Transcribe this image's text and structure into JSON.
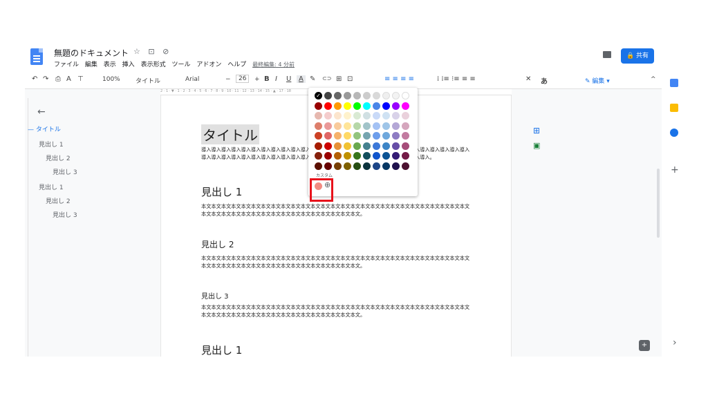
{
  "header": {
    "doc_title": "無題のドキュメント",
    "title_icons": "☆ ⊡ ⊘",
    "menus": [
      "ファイル",
      "編集",
      "表示",
      "挿入",
      "表示形式",
      "ツール",
      "アドオン",
      "ヘルプ"
    ],
    "last_edit": "最終編集: 4 分前",
    "share_label": "共有"
  },
  "toolbar": {
    "undo": "↶",
    "redo": "↷",
    "print": "⎙",
    "spell": "A",
    "paint": "⊤",
    "zoom": "100%",
    "style": "タイトル",
    "font": "Arial",
    "size": "26",
    "bold": "B",
    "italic": "I",
    "underline": "U",
    "textcolor": "A",
    "highlight": "✎",
    "link": "⊂⊃",
    "comment": "⊞",
    "image": "⊡",
    "editmode": "編集",
    "align_icons": "≡ ≡ ≡ ≡",
    "list_icons": "⁞ ⁞≡ ⁝≡ ≡ ≡",
    "clear": "✕",
    "input": "あ"
  },
  "ruler_text": "2 · 1 · ▼ · 1 · 2 · 3 · 4 · 5 · 6 · 7 · 8 · 9 · 10 · 11 · 12 · 13 · 14 · 15 · ▲ · 17 · 18",
  "outline": [
    {
      "label": "タイトル",
      "level": 0
    },
    {
      "label": "見出し 1",
      "level": 1
    },
    {
      "label": "見出し 2",
      "level": 2
    },
    {
      "label": "見出し 3",
      "level": 3
    },
    {
      "label": "見出し 1",
      "level": 1
    },
    {
      "label": "見出し 2",
      "level": 2
    },
    {
      "label": "見出し 3",
      "level": 3
    }
  ],
  "document": {
    "title": "タイトル",
    "intro": "導入導入導入導入導入導入導入導入導入導入導入導入導入導入導入導入導入導入導入導入導入導入導入導入導入導入導入導入導入導入導入導入導入導入導入導入導入導入導入導入導入導入導入導入導入導入導入導入導入導入。",
    "h1a": "見出し 1",
    "body1": "本文本文本文本文本文本文本文本文本文本文本文本文本文本文本文本文本文本文本文本文本文本文本文本文本文本文本文本文本文本文本文本文本文本文本文本文本文本文本文本文本文本文本文。",
    "h2": "見出し 2",
    "body2": "本文本文本文本文本文本文本文本文本文本文本文本文本文本文本文本文本文本文本文本文本文本文本文本文本文本文本文本文本文本文本文本文本文本文本文本文本文本文本文本文本文本文本文。",
    "h3": "見出し 3",
    "body3": "本文本文本文本文本文本文本文本文本文本文本文本文本文本文本文本文本文本文本文本文本文本文本文本文本文本文本文本文本文本文本文本文本文本文本文本文本文本文本文本文本文本文本文。",
    "h1b": "見出し 1"
  },
  "palette": {
    "custom_label": "カスタム",
    "add_icon": "⊕",
    "rows": [
      [
        "#000000",
        "#434343",
        "#666666",
        "#999999",
        "#b7b7b7",
        "#cccccc",
        "#d9d9d9",
        "#efefef",
        "#f3f3f3",
        "#ffffff"
      ],
      [
        "#980000",
        "#ff0000",
        "#ff9900",
        "#ffff00",
        "#00ff00",
        "#00ffff",
        "#4a86e8",
        "#0000ff",
        "#9900ff",
        "#ff00ff"
      ],
      [
        "#e6b8af",
        "#f4cccc",
        "#fce5cd",
        "#fff2cc",
        "#d9ead3",
        "#d0e0e3",
        "#c9daf8",
        "#cfe2f3",
        "#d9d2e9",
        "#ead1dc"
      ],
      [
        "#dd7e6b",
        "#ea9999",
        "#f9cb9c",
        "#ffe599",
        "#b6d7a8",
        "#a2c4c9",
        "#a4c2f4",
        "#9fc5e8",
        "#b4a7d6",
        "#d5a6bd"
      ],
      [
        "#cc4125",
        "#e06666",
        "#f6b26b",
        "#ffd966",
        "#93c47d",
        "#76a5af",
        "#6d9eeb",
        "#6fa8dc",
        "#8e7cc3",
        "#c27ba0"
      ],
      [
        "#a61c00",
        "#cc0000",
        "#e69138",
        "#f1c232",
        "#6aa84f",
        "#45818e",
        "#3c78d8",
        "#3d85c6",
        "#674ea7",
        "#a64d79"
      ],
      [
        "#85200c",
        "#990000",
        "#b45f06",
        "#bf9000",
        "#38761d",
        "#134f5c",
        "#1155cc",
        "#0b5394",
        "#351c75",
        "#741b47"
      ],
      [
        "#5b0f00",
        "#660000",
        "#783f04",
        "#7f6000",
        "#274e13",
        "#0c343d",
        "#1c4587",
        "#073763",
        "#20124d",
        "#4c1130"
      ]
    ],
    "custom_color": "#f28b82",
    "selected_color": "#000000"
  },
  "right_icons": {
    "add_icon": "⊞",
    "image_icon": "▣",
    "plus": "+",
    "arrow": "›",
    "keep_color": "#fbbc04",
    "calendar_color": "#4285f4",
    "tasks_color": "#1a73e8"
  }
}
